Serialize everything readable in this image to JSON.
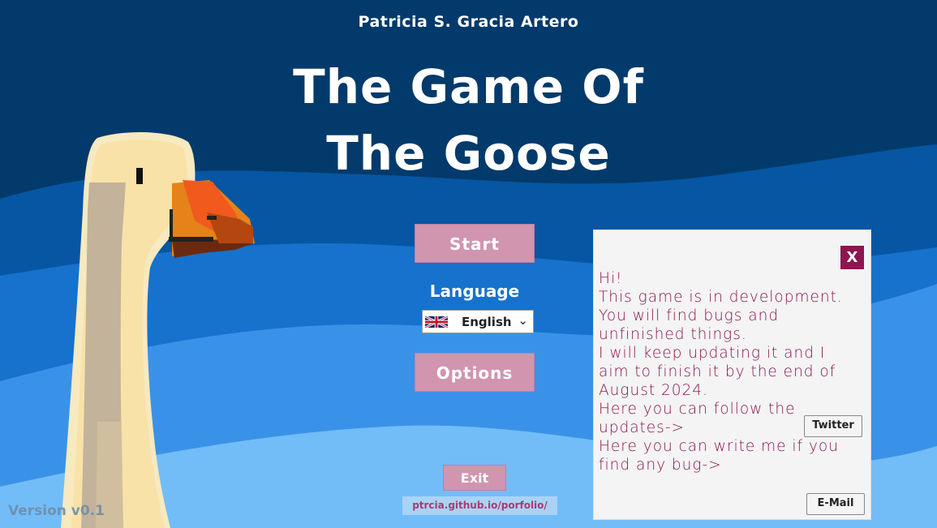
{
  "author": "Patricia S. Gracia Artero",
  "title_line1": "The Game Of",
  "title_line2": "The Goose",
  "buttons": {
    "start": "Start",
    "options": "Options",
    "exit": "Exit"
  },
  "language": {
    "label": "Language",
    "selected": "English",
    "flag_icon": "uk-flag-icon"
  },
  "portfolio_link": "ptrcia.github.io/porfolio/",
  "version": "Version v0.1",
  "panel": {
    "close": "X",
    "lines": [
      "Hi!",
      "This game is in development.",
      "You will find bugs and",
      "unfinished things.",
      "I will keep updating it and I",
      "aim to finish it by the end of",
      "August 2024.",
      "Here you can follow the",
      "updates->",
      "Here you can write me if you",
      "find any bug->"
    ],
    "twitter_button": "Twitter",
    "email_button": "E-Mail"
  },
  "colors": {
    "button": "#d195af",
    "panel_text": "#8c1650",
    "close_bg": "#8c1650"
  }
}
